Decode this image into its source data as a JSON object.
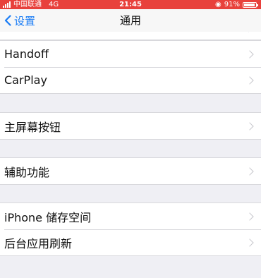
{
  "status_bar": {
    "carrier": "中国联通",
    "network": "4G",
    "time": "21:45",
    "battery": "91%",
    "battery_level": 0.91,
    "background_color": "#e8413c"
  },
  "nav": {
    "back_label": "设置",
    "title": "通用"
  },
  "groups": [
    {
      "items": [
        {
          "label": "Handoff"
        },
        {
          "label": "CarPlay"
        }
      ]
    },
    {
      "items": [
        {
          "label": "主屏幕按钮"
        }
      ]
    },
    {
      "items": [
        {
          "label": "辅助功能"
        }
      ]
    },
    {
      "items": [
        {
          "label": "iPhone 储存空间"
        },
        {
          "label": "后台应用刷新"
        }
      ]
    }
  ],
  "colors": {
    "accent": "#1a7cf5",
    "background": "#efeff4"
  }
}
